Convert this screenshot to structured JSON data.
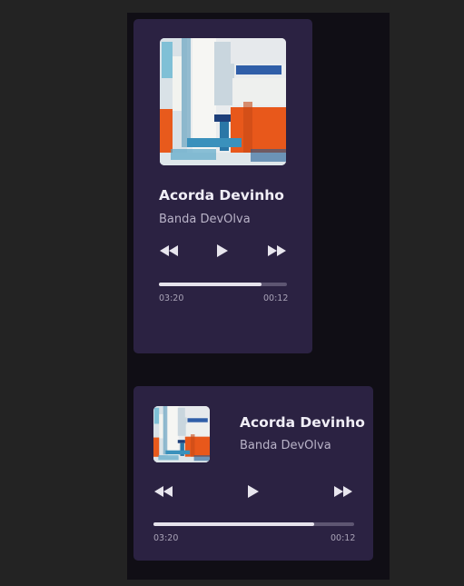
{
  "players": [
    {
      "title": "Acorda Devinho",
      "artist": "Banda DevOlva",
      "elapsed": "03:20",
      "remaining": "00:12",
      "progress": 0.8
    },
    {
      "title": "Acorda Devinho",
      "artist": "Banda DevOlva",
      "elapsed": "03:20",
      "remaining": "00:12",
      "progress": 0.8
    }
  ],
  "icons": {
    "previous": "rewind-icon",
    "play": "play-icon",
    "next": "fast-forward-icon"
  },
  "colors": {
    "card_background": "#2b2242",
    "page_background": "#100e15",
    "progress_fill": "#e6e3ec",
    "progress_track": "#5e5672"
  }
}
